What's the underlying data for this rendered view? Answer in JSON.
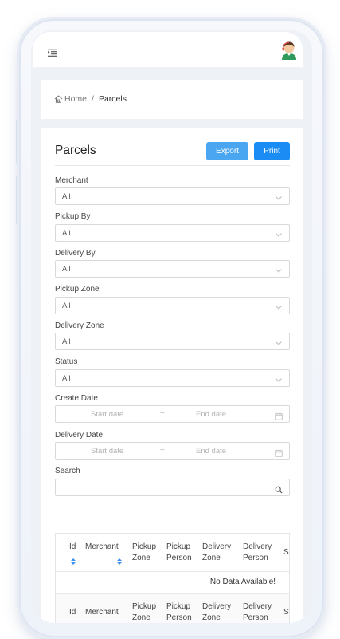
{
  "breadcrumb": {
    "home": "Home",
    "separator": "/",
    "current": "Parcels"
  },
  "page": {
    "title": "Parcels"
  },
  "actions": {
    "export_label": "Export",
    "print_label": "Print"
  },
  "filters": {
    "merchant": {
      "label": "Merchant",
      "value": "All"
    },
    "pickup_by": {
      "label": "Pickup By",
      "value": "All"
    },
    "delivery_by": {
      "label": "Delivery By",
      "value": "All"
    },
    "pickup_zone": {
      "label": "Pickup Zone",
      "value": "All"
    },
    "delivery_zone": {
      "label": "Delivery Zone",
      "value": "All"
    },
    "status": {
      "label": "Status",
      "value": "All"
    },
    "create_date": {
      "label": "Create Date",
      "start_placeholder": "Start date",
      "separator": "~",
      "end_placeholder": "End date"
    },
    "delivery_date": {
      "label": "Delivery Date",
      "start_placeholder": "Start date",
      "separator": "~",
      "end_placeholder": "End date"
    },
    "search": {
      "label": "Search",
      "value": ""
    }
  },
  "table": {
    "header": {
      "id": "Id",
      "merchant": "Merchant",
      "pickup_zone_1": "Pickup",
      "pickup_zone_2": "Zone",
      "pickup_person_1": "Pickup",
      "pickup_person_2": "Person",
      "delivery_zone_1": "Delivery",
      "delivery_zone_2": "Zone",
      "delivery_person_1": "Delivery",
      "delivery_person_2": "Person",
      "status_partial": "St"
    },
    "empty_text": "No Data Available!"
  },
  "colors": {
    "accent": "#1a8cf3",
    "export": "#4aa6f0",
    "sort_icon": "#3b8ff0"
  },
  "icons": [
    "menu-unfold-icon",
    "avatar-icon",
    "home-icon",
    "chevron-down-icon",
    "calendar-icon",
    "search-icon",
    "sort-icon"
  ]
}
